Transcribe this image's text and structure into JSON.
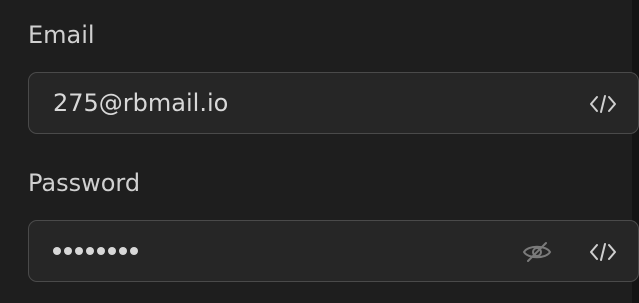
{
  "form": {
    "email": {
      "label": "Email",
      "value": "275@rbmail.io",
      "action_icon": "code-icon"
    },
    "password": {
      "label": "Password",
      "masked_length": 8,
      "toggle_icon": "eye-off-icon",
      "action_icon": "code-icon"
    }
  },
  "colors": {
    "background": "#1e1e1e",
    "field_background": "#262626",
    "field_border": "#4a4a4a",
    "label_text": "#d0d0d0",
    "value_text": "#d8d8d8",
    "icon": "#cfcfcf",
    "eye_icon": "#7a7a7a"
  }
}
